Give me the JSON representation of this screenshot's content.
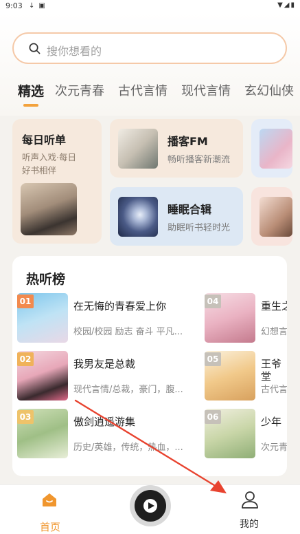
{
  "status": {
    "time": "9:03"
  },
  "search": {
    "placeholder": "搜你想看的"
  },
  "tabs": [
    "精选",
    "次元青春",
    "古代言情",
    "现代言情",
    "玄幻仙侠"
  ],
  "featured": {
    "daily": {
      "title": "每日听单",
      "line1": "听声入戏·每日",
      "line2": "好书相伴"
    },
    "podcast": {
      "title": "播客FM",
      "subtitle": "畅听播客新潮流"
    },
    "sleep": {
      "title": "睡眠合辑",
      "subtitle": "助眠听书轻时光"
    }
  },
  "hot": {
    "title": "热听榜",
    "books": [
      {
        "rank": "01",
        "name": "在无悔的青春爱上你",
        "meta": "校园/校园 励志 奋斗 平凡..."
      },
      {
        "rank": "02",
        "name": "我男友是总裁",
        "meta": "现代言情/总裁，豪门，腹..."
      },
      {
        "rank": "03",
        "name": "傲剑逍遥游集",
        "meta": "历史/英雄，传统，热血，..."
      },
      {
        "rank": "04",
        "name": "重生之",
        "meta": "幻想言"
      },
      {
        "rank": "05",
        "name": "王爷",
        "name2": "堂",
        "meta": "古代言"
      },
      {
        "rank": "06",
        "name": "少年",
        "meta": "次元青"
      }
    ]
  },
  "nav": {
    "home": "首页",
    "me": "我的"
  },
  "colors": {
    "accent": "#f0962e",
    "arrow": "#e8432f"
  }
}
